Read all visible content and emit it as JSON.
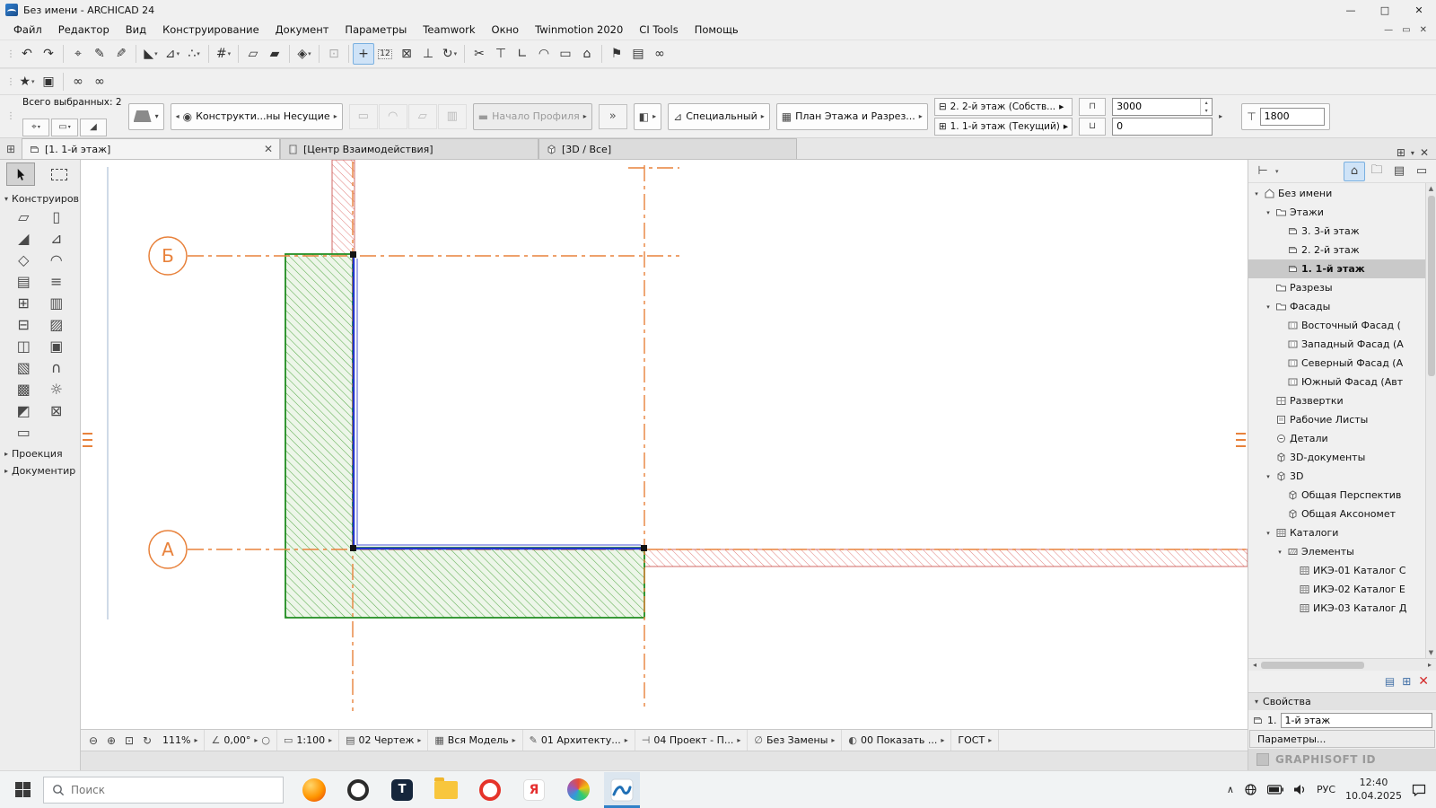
{
  "colors": {
    "accent_orange": "#E8823C",
    "selection_blue": "#2334CC",
    "wall_green": "#1F8C1F",
    "hatch_red": "#D06A66",
    "tool_active_bg": "#CFE3F7"
  },
  "window": {
    "title": "Без имени - ARCHICAD 24"
  },
  "menu": {
    "items": [
      "Файл",
      "Редактор",
      "Вид",
      "Конструирование",
      "Документ",
      "Параметры",
      "Teamwork",
      "Окно",
      "Twinmotion 2020",
      "CI Tools",
      "Помощь"
    ]
  },
  "toolbar_main": [
    {
      "icon": "undo"
    },
    {
      "icon": "redo"
    },
    "|",
    {
      "icon": "select-criteria"
    },
    {
      "icon": "pickup-params"
    },
    {
      "icon": "inject-params"
    },
    "|",
    {
      "icon": "guide-lines",
      "drop": true
    },
    {
      "icon": "snap-ruler",
      "drop": true
    },
    {
      "icon": "snap-points",
      "drop": true
    },
    "|",
    {
      "icon": "snap-grid",
      "drop": true
    },
    "|",
    {
      "icon": "plane-1"
    },
    {
      "icon": "plane-2"
    },
    "|",
    {
      "icon": "view-cube",
      "drop": true
    },
    "|",
    {
      "icon": "lock",
      "disabled": true
    },
    "|",
    {
      "icon": "move",
      "active": true
    },
    {
      "icon": "dimension-12"
    },
    {
      "icon": "stretch"
    },
    {
      "icon": "align"
    },
    {
      "icon": "rotate",
      "drop": true
    },
    "|",
    {
      "icon": "split"
    },
    {
      "icon": "adjust"
    },
    {
      "icon": "intersect"
    },
    {
      "icon": "fillet"
    },
    {
      "icon": "trim-frame"
    },
    {
      "icon": "home-story"
    },
    "|",
    {
      "icon": "flag"
    },
    {
      "icon": "layers"
    },
    {
      "icon": "link"
    }
  ],
  "toolbar_quick": [
    {
      "icon": "favorites",
      "drop": true
    },
    {
      "icon": "save"
    },
    "|",
    {
      "icon": "link-1"
    },
    {
      "icon": "link-2"
    }
  ],
  "infobar": {
    "selected_label": "Всего выбранных: 2",
    "element_filter": "Конструкти...ны Несущие",
    "profile_placeholder": "Начало Профиля",
    "complexity": "Специальный",
    "display_mode": "План Этажа и Разрез...",
    "story_link_top": "2. 2-й этаж (Собств...",
    "story_link_current": "1. 1-й этаж (Текущий)",
    "top_offset": "3000",
    "base_offset": "0",
    "reference_offset": "1800"
  },
  "tabs": {
    "items": [
      {
        "label": "[1. 1-й этаж]",
        "active": true
      },
      {
        "label": "[Центр Взаимодействия]",
        "active": false
      },
      {
        "label": "[3D / Все]",
        "active": false
      }
    ]
  },
  "toolbox": {
    "header_design": "Конструиров",
    "header_projection": "Проекция",
    "header_document": "Документир",
    "tools": [
      "wall",
      "column",
      "beam",
      "window",
      "roof",
      "shell",
      "mesh",
      "railing",
      "curtain-wall",
      "slab",
      "grid-element",
      "stack",
      "frame",
      "object",
      "ramp",
      "dome",
      "stair",
      "lamp",
      "morph",
      "zone",
      "door"
    ]
  },
  "canvas": {
    "axis_bubbles": [
      {
        "label": "Б"
      },
      {
        "label": "А"
      }
    ]
  },
  "navigator": {
    "tree": [
      {
        "label": "Без имени",
        "level": 0,
        "icon": "home",
        "exp": "open"
      },
      {
        "label": "Этажи",
        "level": 1,
        "icon": "folder",
        "exp": "open"
      },
      {
        "label": "3. 3-й этаж",
        "level": 2,
        "icon": "story"
      },
      {
        "label": "2. 2-й этаж",
        "level": 2,
        "icon": "story"
      },
      {
        "label": "1. 1-й этаж",
        "level": 2,
        "icon": "story",
        "selected": true
      },
      {
        "label": "Разрезы",
        "level": 1,
        "icon": "folder"
      },
      {
        "label": "Фасады",
        "level": 1,
        "icon": "folder",
        "exp": "open"
      },
      {
        "label": "Восточный Фасад (",
        "level": 2,
        "icon": "building"
      },
      {
        "label": "Западный Фасад (А",
        "level": 2,
        "icon": "building"
      },
      {
        "label": "Северный Фасад (А",
        "level": 2,
        "icon": "building"
      },
      {
        "label": "Южный Фасад (Авт",
        "level": 2,
        "icon": "building"
      },
      {
        "label": "Развертки",
        "level": 1,
        "icon": "interior"
      },
      {
        "label": "Рабочие Листы",
        "level": 1,
        "icon": "worksheet"
      },
      {
        "label": "Детали",
        "level": 1,
        "icon": "detail"
      },
      {
        "label": "3D-документы",
        "level": 1,
        "icon": "box"
      },
      {
        "label": "3D",
        "level": 1,
        "icon": "box",
        "exp": "open"
      },
      {
        "label": "Общая Перспектив",
        "level": 2,
        "icon": "box"
      },
      {
        "label": "Общая Аксономет",
        "level": 2,
        "icon": "box"
      },
      {
        "label": "Каталоги",
        "level": 1,
        "icon": "grid",
        "exp": "open"
      },
      {
        "label": "Элементы",
        "level": 2,
        "icon": "hatch",
        "exp": "open"
      },
      {
        "label": "ИКЭ-01 Каталог С",
        "level": 3,
        "icon": "grid"
      },
      {
        "label": "ИКЭ-02 Каталог Е",
        "level": 3,
        "icon": "grid"
      },
      {
        "label": "ИКЭ-03 Каталог Д",
        "level": 3,
        "icon": "grid"
      }
    ],
    "properties_title": "Свойства",
    "story_number": "1.",
    "story_name": "1-й этаж",
    "settings_button": "Параметры...",
    "brand": "GRAPHISOFT ID"
  },
  "statusbar": {
    "zoom": "111%",
    "rotation": "0,00°",
    "scale": "1:100",
    "pen_set": "02 Чертеж",
    "model_filter": "Вся Модель",
    "layer_combination": "01 Архитекту...",
    "dimension_style": "04 Проект - П...",
    "override": "Без Замены",
    "renovation_filter": "00 Показать ...",
    "standard": "ГОСТ"
  },
  "taskbar": {
    "search_placeholder": "Поиск",
    "language": "РУС",
    "time": "12:40",
    "date": "10.04.2025"
  }
}
